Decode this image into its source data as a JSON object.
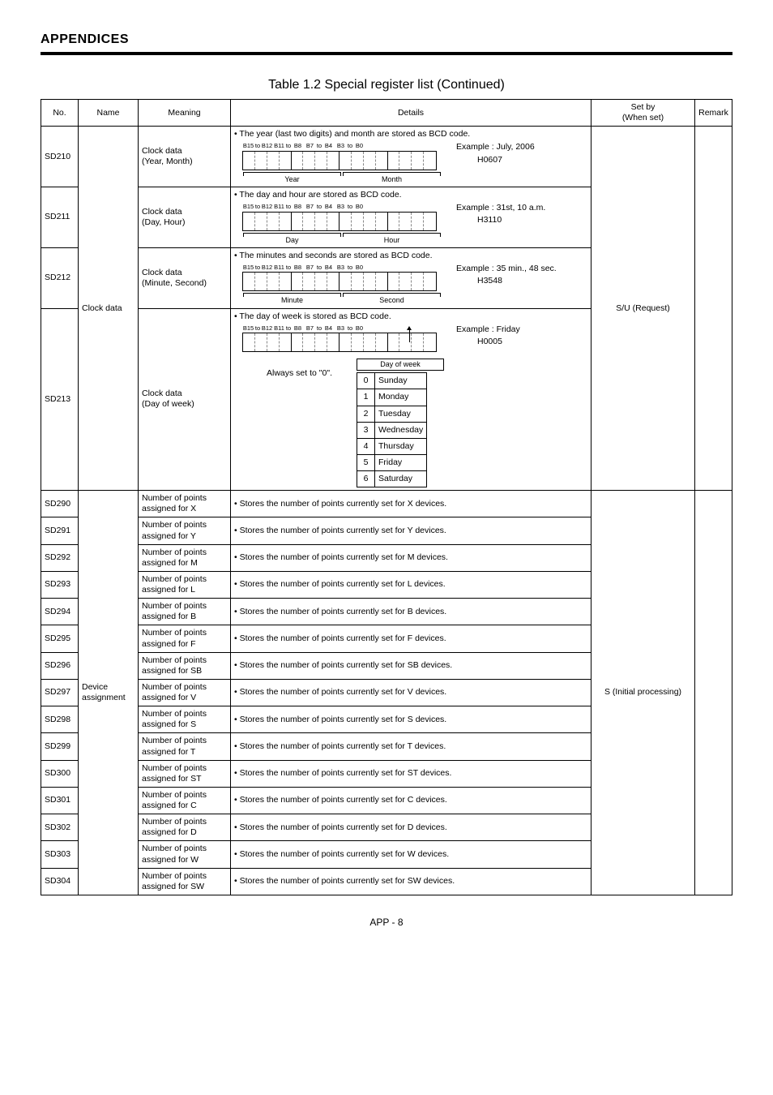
{
  "header": "APPENDICES",
  "tableTitle": "Table 1.2 Special register list (Continued)",
  "columns": {
    "no": "No.",
    "name": "Name",
    "meaning": "Meaning",
    "details": "Details",
    "setby_l1": "Set by",
    "setby_l2": "(When set)",
    "remark": "Remark"
  },
  "clock": {
    "name": "Clock data",
    "setby": "S/U (Request)",
    "rows": [
      {
        "no": "SD210",
        "meaning_l1": "Clock data",
        "meaning_l2": "(Year, Month)",
        "intro": "The year (last two digits) and month are stored as BCD code.",
        "example_label": "Example : July, 2006",
        "example_value": "H0607",
        "grp1": "Year",
        "grp2": "Month"
      },
      {
        "no": "SD211",
        "meaning_l1": "Clock data",
        "meaning_l2": "(Day, Hour)",
        "intro": "The day and hour are stored as BCD code.",
        "example_label": "Example : 31st, 10 a.m.",
        "example_value": "H3110",
        "grp1": "Day",
        "grp2": "Hour"
      },
      {
        "no": "SD212",
        "meaning_l1": "Clock data",
        "meaning_l2": "(Minute, Second)",
        "intro": "The minutes and seconds are stored as BCD code.",
        "example_label": "Example : 35 min., 48 sec.",
        "example_value": "H3548",
        "grp1": "Minute",
        "grp2": "Second"
      },
      {
        "no": "SD213",
        "meaning_l1": "Clock data",
        "meaning_l2": "(Day of week)",
        "intro": "The day of week is stored as BCD code.",
        "example_label": "Example : Friday",
        "example_value": "H0005",
        "always0": "Always set to \"0\".",
        "dow_caption": "Day of week",
        "dow": [
          {
            "n": "0",
            "d": "Sunday"
          },
          {
            "n": "1",
            "d": "Monday"
          },
          {
            "n": "2",
            "d": "Tuesday"
          },
          {
            "n": "3",
            "d": "Wednesday"
          },
          {
            "n": "4",
            "d": "Thursday"
          },
          {
            "n": "5",
            "d": "Friday"
          },
          {
            "n": "6",
            "d": "Saturday"
          }
        ]
      }
    ],
    "bits": [
      "B15",
      "to",
      "B12",
      "B11",
      "to",
      "B8",
      "B7",
      "to",
      "B4",
      "B3",
      "to",
      "B0"
    ]
  },
  "device": {
    "name_l1": "Device",
    "name_l2": "assignment",
    "setby": "S (Initial processing)",
    "rows": [
      {
        "no": "SD290",
        "m1": "Number of points",
        "m2": "assigned for X",
        "d": "Stores the number of points currently set for X devices."
      },
      {
        "no": "SD291",
        "m1": "Number of points",
        "m2": "assigned for Y",
        "d": "Stores the number of points currently set for Y devices."
      },
      {
        "no": "SD292",
        "m1": "Number of points",
        "m2": "assigned for M",
        "d": "Stores the number of points currently set for M devices."
      },
      {
        "no": "SD293",
        "m1": "Number of points",
        "m2": "assigned for L",
        "d": "Stores the number of points currently set for L devices."
      },
      {
        "no": "SD294",
        "m1": "Number of points",
        "m2": "assigned for B",
        "d": "Stores the number of points currently set for B devices."
      },
      {
        "no": "SD295",
        "m1": "Number of points",
        "m2": "assigned for F",
        "d": "Stores the number of points currently set for F devices."
      },
      {
        "no": "SD296",
        "m1": "Number of points",
        "m2": "assigned for SB",
        "d": "Stores the number of points currently set for SB devices."
      },
      {
        "no": "SD297",
        "m1": "Number of points",
        "m2": "assigned for V",
        "d": "Stores the number of points currently set for V devices."
      },
      {
        "no": "SD298",
        "m1": "Number of points",
        "m2": "assigned for S",
        "d": "Stores the number of points currently set for S devices."
      },
      {
        "no": "SD299",
        "m1": "Number of points",
        "m2": "assigned for T",
        "d": "Stores the number of points currently set for T devices."
      },
      {
        "no": "SD300",
        "m1": "Number of points",
        "m2": "assigned for ST",
        "d": "Stores the number of points currently set for ST devices."
      },
      {
        "no": "SD301",
        "m1": "Number of points",
        "m2": "assigned for C",
        "d": "Stores the number of points currently set for C devices."
      },
      {
        "no": "SD302",
        "m1": "Number of points",
        "m2": "assigned for D",
        "d": "Stores the number of points currently set for D devices."
      },
      {
        "no": "SD303",
        "m1": "Number of points",
        "m2": "assigned for W",
        "d": "Stores the number of points currently set for W devices."
      },
      {
        "no": "SD304",
        "m1": "Number of points",
        "m2": "assigned for SW",
        "d": "Stores the number of points currently set for SW devices."
      }
    ]
  },
  "footer": "APP - 8"
}
